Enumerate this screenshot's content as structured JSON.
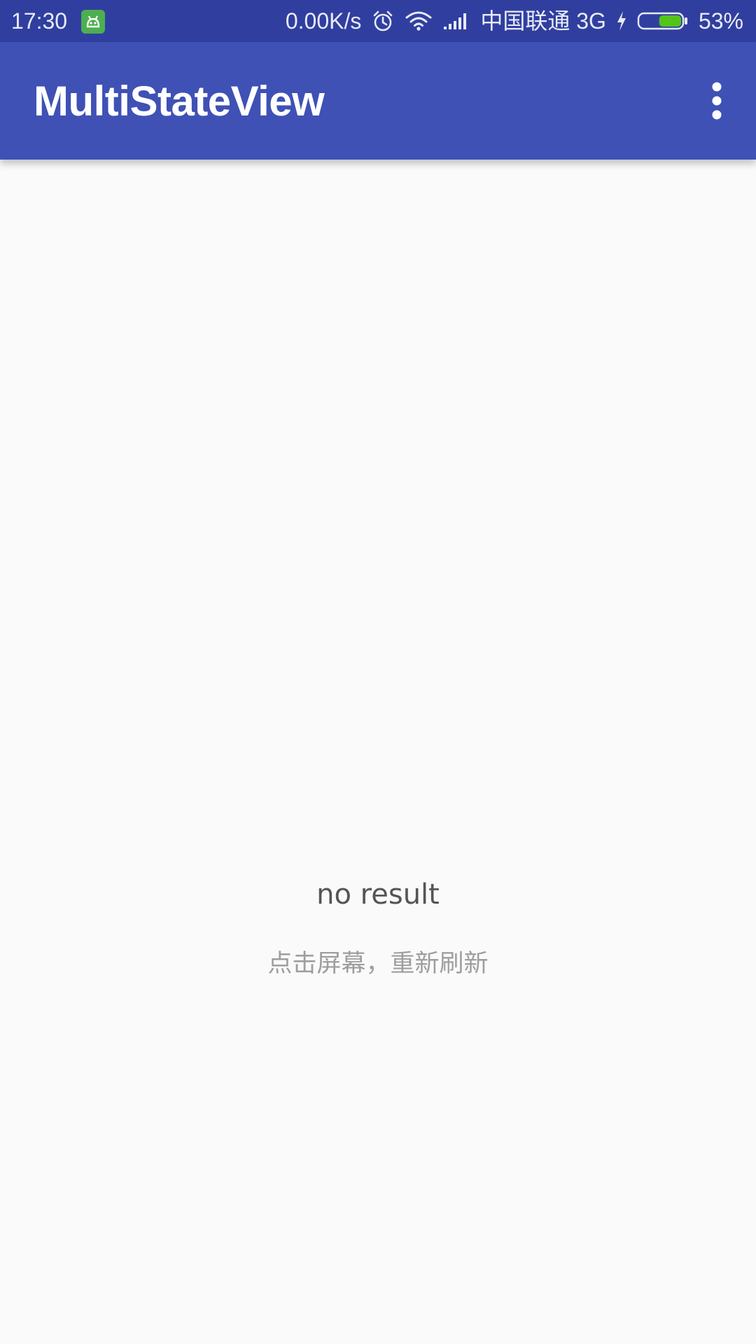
{
  "status_bar": {
    "time": "17:30",
    "app_icon": "android-notification-icon",
    "net_speed": "0.00K/s",
    "alarm_icon": "alarm-icon",
    "wifi_icon": "wifi-icon",
    "signal_icon": "signal-icon",
    "carrier": "中国联通 3G",
    "charging_icon": "charging-bolt-icon",
    "battery_icon": "battery-icon",
    "battery_level": 0.53,
    "battery_percent": "53%",
    "colors": {
      "background": "#303f9f",
      "battery_fill": "#52c41a"
    }
  },
  "app_bar": {
    "title": "MultiStateView",
    "overflow_icon": "more-vert-icon",
    "colors": {
      "background": "#3f51b5",
      "title": "#ffffff"
    }
  },
  "empty_state": {
    "title": "no result",
    "hint": "点击屏幕，重新刷新",
    "colors": {
      "title": "#555555",
      "hint": "#9e9e9e",
      "background": "#fafafa"
    }
  }
}
